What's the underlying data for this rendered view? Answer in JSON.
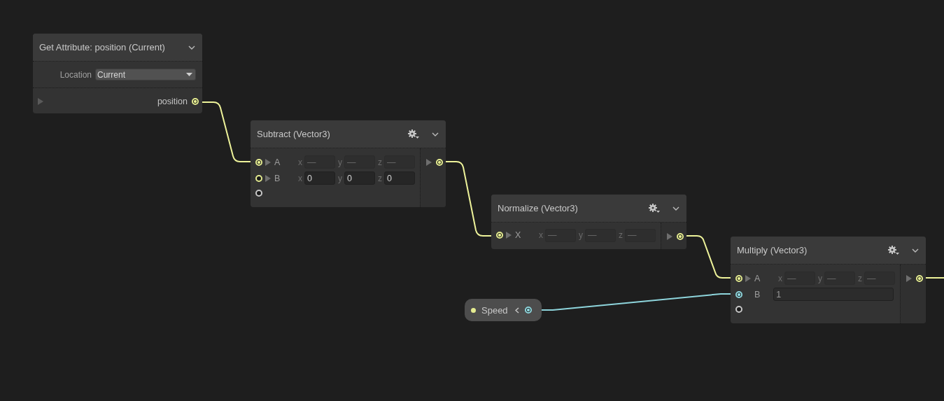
{
  "nodes": [
    {
      "title": "Get Attribute: position (Current)",
      "settings": false,
      "location": {
        "label": "Location",
        "value": "Current"
      },
      "outputs": [
        {
          "kind": "vector",
          "label": "position",
          "connected": true
        }
      ]
    },
    {
      "title": "Subtract (Vector3)",
      "settings": true,
      "inputs": [
        {
          "kind": "vector",
          "label": "A",
          "connected": true,
          "fields": [
            {
              "axis": "x",
              "value": "—"
            },
            {
              "axis": "y",
              "value": "—"
            },
            {
              "axis": "z",
              "value": "—"
            }
          ]
        },
        {
          "kind": "vector",
          "label": "B",
          "connected": false,
          "fields": [
            {
              "axis": "x",
              "value": "0"
            },
            {
              "axis": "y",
              "value": "0"
            },
            {
              "axis": "z",
              "value": "0"
            }
          ]
        },
        {
          "kind": "empty",
          "connected": false
        }
      ],
      "outputs": [
        {
          "kind": "vector",
          "connected": true
        }
      ]
    },
    {
      "title": "Normalize (Vector3)",
      "settings": true,
      "inputs": [
        {
          "kind": "vector",
          "label": "X",
          "connected": true,
          "fields": [
            {
              "axis": "x",
              "value": "—"
            },
            {
              "axis": "y",
              "value": "—"
            },
            {
              "axis": "z",
              "value": "—"
            }
          ]
        }
      ],
      "outputs": [
        {
          "kind": "vector",
          "connected": true
        }
      ]
    },
    {
      "title": "Multiply (Vector3)",
      "settings": true,
      "inputs": [
        {
          "kind": "vector",
          "label": "A",
          "connected": true,
          "fields": [
            {
              "axis": "x",
              "value": "—"
            },
            {
              "axis": "y",
              "value": "—"
            },
            {
              "axis": "z",
              "value": "—"
            }
          ]
        },
        {
          "kind": "float",
          "label": "B",
          "connected": true,
          "fields": [
            {
              "value": "1"
            }
          ]
        },
        {
          "kind": "empty",
          "connected": false
        }
      ],
      "outputs": [
        {
          "kind": "vector",
          "connected": true
        }
      ]
    }
  ],
  "parameter": {
    "label": "Speed",
    "connected": true
  }
}
